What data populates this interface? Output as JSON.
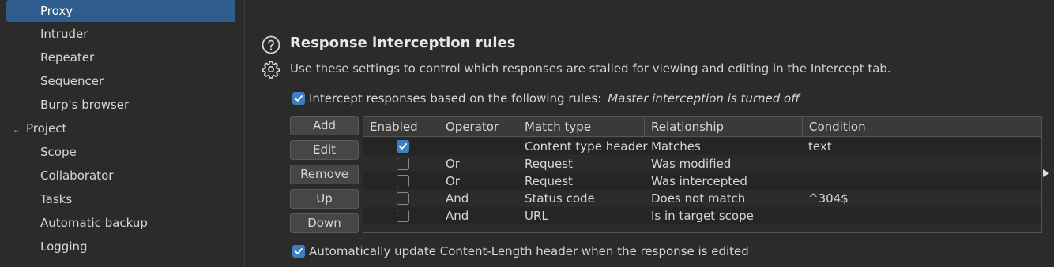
{
  "sidebar": {
    "items": [
      {
        "label": "Proxy",
        "selected": true
      },
      {
        "label": "Intruder"
      },
      {
        "label": "Repeater"
      },
      {
        "label": "Sequencer"
      },
      {
        "label": "Burp's browser"
      }
    ],
    "project_section": "Project",
    "project_items": [
      {
        "label": "Scope"
      },
      {
        "label": "Collaborator"
      },
      {
        "label": "Tasks"
      },
      {
        "label": "Automatic backup"
      },
      {
        "label": "Logging"
      }
    ]
  },
  "section": {
    "title": "Response interception rules",
    "description": "Use these settings to control which responses are stalled for viewing and editing in the Intercept tab."
  },
  "intercept_rules": {
    "label": "Intercept responses based on the following rules:",
    "note": "Master interception is turned off",
    "checked": true
  },
  "buttons": {
    "add": "Add",
    "edit": "Edit",
    "remove": "Remove",
    "up": "Up",
    "down": "Down"
  },
  "table": {
    "columns": [
      "Enabled",
      "Operator",
      "Match type",
      "Relationship",
      "Condition"
    ],
    "rows": [
      {
        "enabled": true,
        "operator": "",
        "match_type": "Content type header",
        "relationship": "Matches",
        "condition": "text"
      },
      {
        "enabled": false,
        "operator": "Or",
        "match_type": "Request",
        "relationship": "Was modified",
        "condition": ""
      },
      {
        "enabled": false,
        "operator": "Or",
        "match_type": "Request",
        "relationship": "Was intercepted",
        "condition": ""
      },
      {
        "enabled": false,
        "operator": "And",
        "match_type": "Status code",
        "relationship": "Does not match",
        "condition": "^304$"
      },
      {
        "enabled": false,
        "operator": "And",
        "match_type": "URL",
        "relationship": "Is in target scope",
        "condition": ""
      }
    ]
  },
  "auto_update": {
    "label": "Automatically update Content-Length header when the response is edited",
    "checked": true
  },
  "colors": {
    "accent": "#3d7fc1",
    "selected_bg": "#2e5d8e",
    "background": "#2b2b2b"
  }
}
